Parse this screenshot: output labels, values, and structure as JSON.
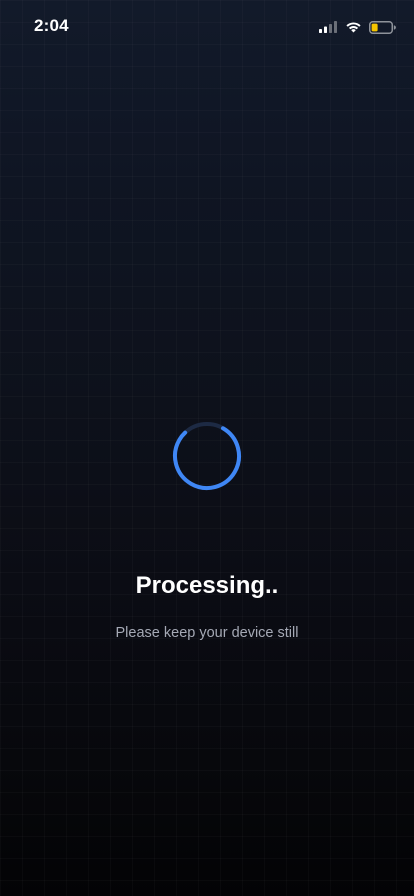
{
  "status_bar": {
    "time": "2:04",
    "icons": [
      "cellular-signal-icon",
      "wifi-icon",
      "battery-icon"
    ],
    "battery_color": "#f5c400"
  },
  "processing": {
    "title": "Processing..",
    "subtitle": "Please keep your device still",
    "spinner_color": "#3f87f5",
    "spinner_track_color": "#1d2a44"
  }
}
